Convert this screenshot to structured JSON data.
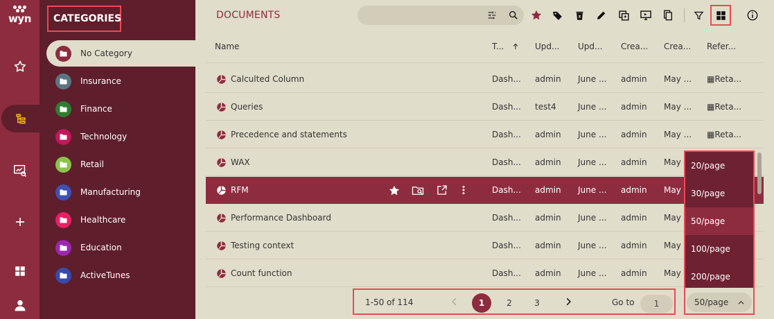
{
  "app": {
    "logo": "wyn"
  },
  "colors": {
    "accent": "#8e2c3f",
    "panel": "#5e1e2b",
    "background": "#e1ddcb",
    "highlight": "#e94a55"
  },
  "rail": {
    "items": [
      "star-icon",
      "category-tree-icon",
      "monitor-analysis-icon",
      "plus-icon",
      "grid-icon",
      "user-icon"
    ]
  },
  "categories": {
    "title": "CATEGORIES",
    "items": [
      {
        "label": "No Category",
        "color": "#8e2c3f"
      },
      {
        "label": "Insurance",
        "color": "#5b7682"
      },
      {
        "label": "Finance",
        "color": "#2e7d32"
      },
      {
        "label": "Technology",
        "color": "#c2185b"
      },
      {
        "label": "Retail",
        "color": "#8bc34a"
      },
      {
        "label": "Manufacturing",
        "color": "#3f51b5"
      },
      {
        "label": "Healthcare",
        "color": "#e91e63"
      },
      {
        "label": "Education",
        "color": "#9c27b0"
      },
      {
        "label": "ActiveTunes",
        "color": "#3949ab"
      }
    ]
  },
  "documents": {
    "title": "DOCUMENTS",
    "columns": [
      "Name",
      "T...",
      "Upd...",
      "Upd...",
      "Crea...",
      "Crea...",
      "Refer..."
    ],
    "rows": [
      {
        "name": "Calculted Column",
        "type": "Dash...",
        "updated_by": "admin",
        "updated": "June ...",
        "created_by": "admin",
        "created": "May ...",
        "ref": "▦Reta..."
      },
      {
        "name": "Queries",
        "type": "Dash...",
        "updated_by": "test4",
        "updated": "June ...",
        "created_by": "admin",
        "created": "May ...",
        "ref": "▦Reta..."
      },
      {
        "name": "Precedence and statements",
        "type": "Dash...",
        "updated_by": "admin",
        "updated": "June ...",
        "created_by": "admin",
        "created": "May ...",
        "ref": "▦Reta..."
      },
      {
        "name": "WAX",
        "type": "Dash...",
        "updated_by": "admin",
        "updated": "June ...",
        "created_by": "admin",
        "created": "May ...",
        "ref": ""
      },
      {
        "name": "RFM",
        "type": "Dash...",
        "updated_by": "admin",
        "updated": "June ...",
        "created_by": "admin",
        "created": "May ...",
        "ref": ""
      },
      {
        "name": "Performance Dashboard",
        "type": "Dash...",
        "updated_by": "admin",
        "updated": "June ...",
        "created_by": "admin",
        "created": "May ...",
        "ref": ""
      },
      {
        "name": "Testing context",
        "type": "Dash...",
        "updated_by": "admin",
        "updated": "June ...",
        "created_by": "admin",
        "created": "May ...",
        "ref": ""
      },
      {
        "name": "Count function",
        "type": "Dash...",
        "updated_by": "admin",
        "updated": "June ...",
        "created_by": "admin",
        "created": "May ...",
        "ref": ""
      }
    ]
  },
  "pager": {
    "range": "1-50 of 114",
    "pages": [
      "1",
      "2",
      "3"
    ],
    "goto_label": "Go to",
    "goto_value": "1"
  },
  "page_size": {
    "options": [
      "20/page",
      "30/page",
      "50/page",
      "100/page",
      "200/page"
    ],
    "selected": "50/page"
  }
}
